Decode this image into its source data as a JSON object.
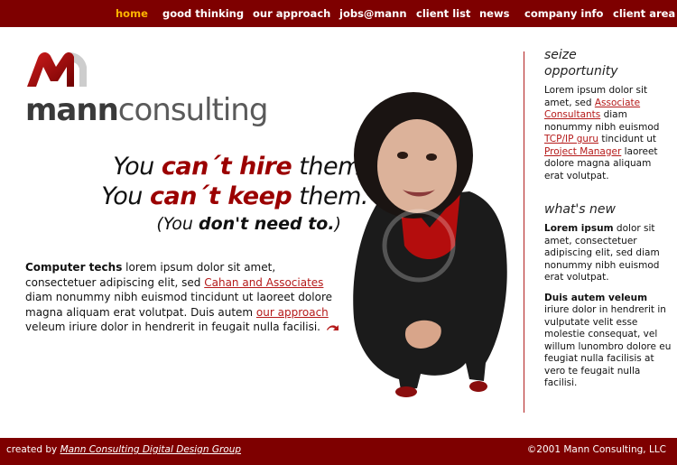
{
  "nav": {
    "items": [
      {
        "label": "home",
        "active": true
      },
      {
        "label": "good thinking"
      },
      {
        "label": "our approach"
      },
      {
        "label": "jobs@mann"
      },
      {
        "label": "client list"
      },
      {
        "label": "news"
      },
      {
        "label": "company info"
      },
      {
        "label": "client area"
      }
    ]
  },
  "logo": {
    "word_bold": "mann",
    "word_light": "consulting"
  },
  "headline": {
    "l1_pre": "You ",
    "l1_em": "can´t hire",
    "l1_post": " them.",
    "l2_pre": "You ",
    "l2_em": "can´t keep",
    "l2_post": " them.",
    "l3_pre": "(You ",
    "l3_bold": "don't need to.",
    "l3_post": ")"
  },
  "intro": {
    "lead": "Computer techs",
    "t1": " lorem ipsum dolor sit amet, consectetuer adipiscing elit, sed ",
    "link1": "Cahan and Associates",
    "t2": " diam nonummy nibh euismod tincidunt ut laoreet dolore magna aliquam erat volutpat. Duis autem ",
    "link2": "our approach",
    "t3": " veleum iriure dolor in hendrerit in feugait nulla facilisi."
  },
  "sidebar": {
    "seize_title_1": "seize",
    "seize_title_2": "opportunity",
    "seize": {
      "t1": "Lorem ipsum dolor sit amet, sed ",
      "link1": "Associate Consultants",
      "t2": " diam nonummy nibh euismod ",
      "link2": "TCP/IP guru",
      "t3": " tincidunt ut ",
      "link3": "Project Manager",
      "t4": " laoreet dolore magna aliquam erat volutpat."
    },
    "news_title": "what's new",
    "news1": {
      "bold": "Lorem ipsum",
      "text": " dolor sit amet, consectetuer adipiscing elit, sed diam nonummy nibh euismod erat volutpat."
    },
    "news2": {
      "bold": "Duis autem veleum",
      "text": " iriure dolor in hendrerit in vulputate velit esse molestie consequat, vel willum lunombro dolore eu feugiat nulla facilisis at vero te feugait nulla facilisi."
    }
  },
  "footer": {
    "prefix": "created by ",
    "link": "Mann Consulting Digital Design Group",
    "copyright": "©2001 Mann Consulting, LLC"
  },
  "colors": {
    "brand": "#7e0000",
    "accent": "#9b0000",
    "nav_active": "#ffb400",
    "link": "#b51a1a"
  }
}
